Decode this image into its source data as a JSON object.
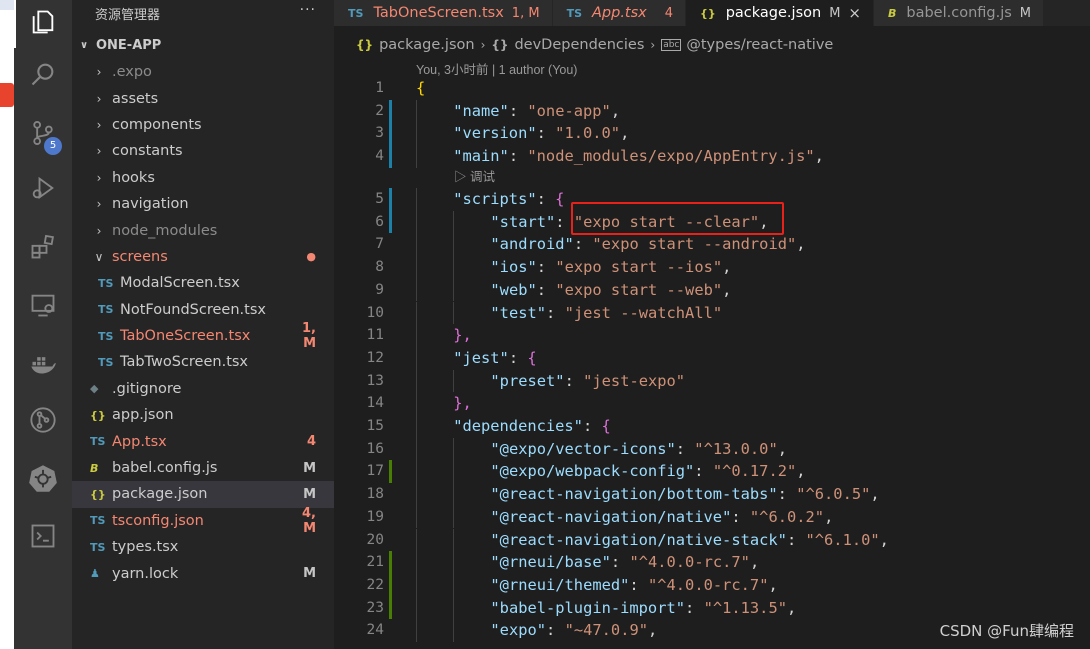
{
  "colors": {
    "accent_blue": "#4d78cc",
    "error_red": "#f48771",
    "highlight_box": "#e8211a"
  },
  "sidebar": {
    "title": "资源管理器",
    "more": "···",
    "project": "ONE-APP",
    "items": [
      {
        "label": ".expo",
        "kind": "folder",
        "icon": "chevron-right-icon",
        "dim": true,
        "decoration": ""
      },
      {
        "label": "assets",
        "kind": "folder",
        "icon": "chevron-right-icon",
        "decoration": ""
      },
      {
        "label": "components",
        "kind": "folder",
        "icon": "chevron-right-icon",
        "decoration": ""
      },
      {
        "label": "constants",
        "kind": "folder",
        "icon": "chevron-right-icon",
        "decoration": ""
      },
      {
        "label": "hooks",
        "kind": "folder",
        "icon": "chevron-right-icon",
        "decoration": ""
      },
      {
        "label": "navigation",
        "kind": "folder",
        "icon": "chevron-right-icon",
        "decoration": ""
      },
      {
        "label": "node_modules",
        "kind": "folder",
        "icon": "chevron-right-icon",
        "dim": true,
        "decoration": ""
      },
      {
        "label": "screens",
        "kind": "folder-open",
        "icon": "chevron-down-icon",
        "error": true,
        "decoration": "●"
      },
      {
        "label": "ModalScreen.tsx",
        "kind": "file",
        "badge": "TS",
        "nested": true,
        "decoration": ""
      },
      {
        "label": "NotFoundScreen.tsx",
        "kind": "file",
        "badge": "TS",
        "nested": true,
        "decoration": ""
      },
      {
        "label": "TabOneScreen.tsx",
        "kind": "file",
        "badge": "TS",
        "nested": true,
        "error": true,
        "decoration": "1, M"
      },
      {
        "label": "TabTwoScreen.tsx",
        "kind": "file",
        "badge": "TS",
        "nested": true,
        "decoration": ""
      },
      {
        "label": ".gitignore",
        "kind": "file",
        "badge": "◆",
        "decoration": ""
      },
      {
        "label": "app.json",
        "kind": "file",
        "badge": "{}",
        "decoration": ""
      },
      {
        "label": "App.tsx",
        "kind": "file",
        "badge": "TS",
        "error": true,
        "decoration": "4"
      },
      {
        "label": "babel.config.js",
        "kind": "file",
        "badge": "B",
        "decoration": "M"
      },
      {
        "label": "package.json",
        "kind": "file",
        "badge": "{}",
        "selected": true,
        "decoration": "M"
      },
      {
        "label": "tsconfig.json",
        "kind": "file",
        "badge": "TS",
        "error": true,
        "decoration": "4, M"
      },
      {
        "label": "types.tsx",
        "kind": "file",
        "badge": "TS",
        "decoration": ""
      },
      {
        "label": "yarn.lock",
        "kind": "file",
        "badge": "♟",
        "decoration": "M"
      }
    ]
  },
  "activity_bar": [
    {
      "name": "explorer-icon",
      "active": true
    },
    {
      "name": "search-icon"
    },
    {
      "name": "source-control-icon",
      "badge": "5"
    },
    {
      "name": "run-debug-icon"
    },
    {
      "name": "extensions-icon"
    },
    {
      "name": "remote-explorer-icon"
    },
    {
      "name": "docker-icon"
    },
    {
      "name": "git-graph-icon"
    },
    {
      "name": "kubernetes-icon"
    },
    {
      "name": "terminal-icon"
    }
  ],
  "tabs": [
    {
      "label": "TabOneScreen.tsx",
      "badge": "TS",
      "decoration": "1, M",
      "error": true
    },
    {
      "label": "App.tsx",
      "badge": "TS",
      "decoration": "4",
      "error": true,
      "italic": true
    },
    {
      "label": "package.json",
      "badge": "{}",
      "decoration": "M",
      "active": true,
      "close": "×"
    },
    {
      "label": "babel.config.js",
      "badge": "B",
      "decoration": "M"
    }
  ],
  "breadcrumb": {
    "file": "package.json",
    "sep1": "›",
    "section": "devDependencies",
    "sep2": "›",
    "leaf": "@types/react-native",
    "leaf_badge": "abc"
  },
  "codelens": {
    "blame": "You, 3小时前 | 1 author (You)",
    "debug": "▷ 调试"
  },
  "code_lines": [
    {
      "n": "1",
      "indent": 0,
      "text": "{"
    },
    {
      "n": "2",
      "indent": 1,
      "key": "name",
      "value": "one-app",
      "comma": true
    },
    {
      "n": "3",
      "indent": 1,
      "key": "version",
      "value": "1.0.0",
      "comma": true
    },
    {
      "n": "4",
      "indent": 1,
      "key": "main",
      "value": "node_modules/expo/AppEntry.js",
      "comma": true
    },
    {
      "n": "5",
      "indent": 1,
      "key": "scripts",
      "open": "{"
    },
    {
      "n": "6",
      "indent": 2,
      "key": "start",
      "value": "expo start --clear",
      "comma": true
    },
    {
      "n": "7",
      "indent": 2,
      "key": "android",
      "value": "expo start --android",
      "comma": true
    },
    {
      "n": "8",
      "indent": 2,
      "key": "ios",
      "value": "expo start --ios",
      "comma": true
    },
    {
      "n": "9",
      "indent": 2,
      "key": "web",
      "value": "expo start --web",
      "comma": true
    },
    {
      "n": "10",
      "indent": 2,
      "key": "test",
      "value": "jest --watchAll"
    },
    {
      "n": "11",
      "indent": 1,
      "text": "},",
      "close": true
    },
    {
      "n": "12",
      "indent": 1,
      "key": "jest",
      "open": "{"
    },
    {
      "n": "13",
      "indent": 2,
      "key": "preset",
      "value": "jest-expo"
    },
    {
      "n": "14",
      "indent": 1,
      "text": "},",
      "close": true
    },
    {
      "n": "15",
      "indent": 1,
      "key": "dependencies",
      "open": "{"
    },
    {
      "n": "16",
      "indent": 2,
      "key": "@expo/vector-icons",
      "value": "^13.0.0",
      "comma": true
    },
    {
      "n": "17",
      "indent": 2,
      "key": "@expo/webpack-config",
      "value": "^0.17.2",
      "comma": true
    },
    {
      "n": "18",
      "indent": 2,
      "key": "@react-navigation/bottom-tabs",
      "value": "^6.0.5",
      "comma": true
    },
    {
      "n": "19",
      "indent": 2,
      "key": "@react-navigation/native",
      "value": "^6.0.2",
      "comma": true
    },
    {
      "n": "20",
      "indent": 2,
      "key": "@react-navigation/native-stack",
      "value": "^6.1.0",
      "comma": true
    },
    {
      "n": "21",
      "indent": 2,
      "key": "@rneui/base",
      "value": "^4.0.0-rc.7",
      "comma": true
    },
    {
      "n": "22",
      "indent": 2,
      "key": "@rneui/themed",
      "value": "^4.0.0-rc.7",
      "comma": true
    },
    {
      "n": "23",
      "indent": 2,
      "key": "babel-plugin-import",
      "value": "^1.13.5",
      "comma": true
    },
    {
      "n": "24",
      "indent": 2,
      "key": "expo",
      "value": "~47.0.9",
      "comma": true
    }
  ],
  "watermark": "CSDN @Fun肆编程"
}
